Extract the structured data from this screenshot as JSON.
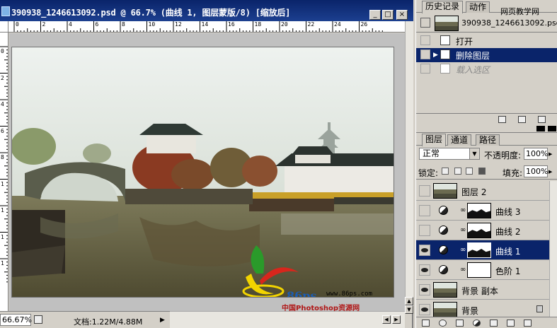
{
  "document": {
    "title": "390938_1246613092.psd @ 66.7% (曲线 1, 图层蒙版/8) [缩放后]",
    "window_buttons": {
      "minimize": "_",
      "maximize": "□",
      "close": "×"
    },
    "ruler_top_labels": [
      "0",
      "2",
      "4",
      "6",
      "8",
      "10",
      "12",
      "14",
      "16",
      "18",
      "20",
      "22",
      "24",
      "26"
    ],
    "ruler_left_labels": [
      "0",
      "2",
      "4",
      "6",
      "8",
      "1",
      "1",
      "1",
      "1"
    ],
    "status": {
      "zoom": "66.67%",
      "doc_size": "文档:1.22M/4.88M",
      "arrow": "▶"
    }
  },
  "watermark": {
    "top_right": "网页教学网",
    "logo_text": "86ps",
    "url": "www.86ps.com",
    "caption": "中国Photoshop资源网"
  },
  "history_panel": {
    "tabs": [
      "历史记录",
      "动作"
    ],
    "snapshot_label": "390938_1246613092.psd",
    "items": [
      {
        "label": "打开",
        "state": "normal"
      },
      {
        "label": "删除图层",
        "state": "selected"
      },
      {
        "label": "载入选区",
        "state": "faded"
      }
    ]
  },
  "layers_panel": {
    "tabs": [
      "图层",
      "通道",
      "路径"
    ],
    "blend_mode": "正常",
    "opacity_label": "不透明度:",
    "opacity_value": "100%",
    "lock_label": "锁定:",
    "fill_label": "填充:",
    "fill_value": "100%",
    "layers": [
      {
        "name": "图层 2",
        "visible": false,
        "type": "pixel",
        "selected": false
      },
      {
        "name": "曲线 3",
        "visible": false,
        "type": "adjustment",
        "selected": false
      },
      {
        "name": "曲线 2",
        "visible": false,
        "type": "adjustment",
        "selected": false
      },
      {
        "name": "曲线 1",
        "visible": true,
        "type": "adjustment",
        "selected": true
      },
      {
        "name": "色阶 1",
        "visible": true,
        "type": "adjustment-white",
        "selected": false
      },
      {
        "name": "背景 副本",
        "visible": true,
        "type": "pixel",
        "selected": false
      },
      {
        "name": "背景",
        "visible": true,
        "type": "pixel",
        "selected": false
      }
    ]
  },
  "colors": {
    "titlebar": "#0a246a",
    "selection": "#0a246a",
    "panel": "#d4d0c8"
  }
}
